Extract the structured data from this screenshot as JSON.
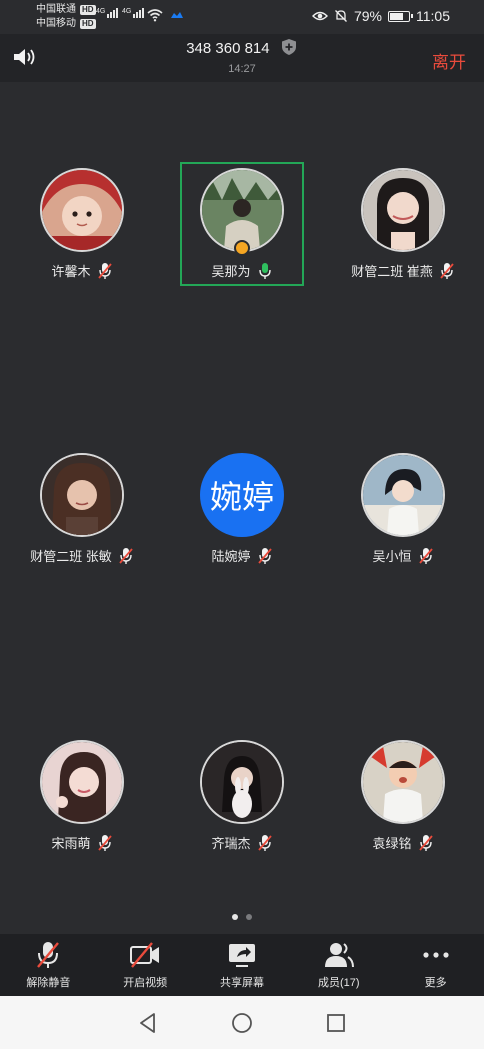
{
  "status": {
    "carrier1": "中国联通",
    "carrier2": "中国移动",
    "hd": "HD",
    "net1": "4G",
    "net2": "4G",
    "battery": "79%",
    "battery_level": 0.79,
    "time": "11:05"
  },
  "header": {
    "meeting_id": "348 360 814",
    "elapsed": "14:27",
    "leave_label": "离开"
  },
  "participants": [
    {
      "name": "许馨木",
      "mic": "muted",
      "avatar_color": "#c93a3a"
    },
    {
      "name": "吴那为",
      "mic": "on",
      "avatar_color": "#5f7a55",
      "host": true,
      "active": true
    },
    {
      "name": "财管二班  崔燕",
      "mic": "muted",
      "avatar_color": "#b0a8a0"
    },
    {
      "name": "财管二班 张敏",
      "mic": "muted",
      "avatar_color": "#4a3a34"
    },
    {
      "name": "陆婉婷",
      "mic": "muted",
      "avatar_text": "婉婷",
      "avatar_color": "#1971f2"
    },
    {
      "name": "吴小恒",
      "mic": "muted",
      "avatar_color": "#6f8fa6"
    },
    {
      "name": "宋雨萌",
      "mic": "muted",
      "avatar_color": "#d7b4b4"
    },
    {
      "name": "齐瑞杰",
      "mic": "muted",
      "avatar_color": "#2e2c2c"
    },
    {
      "name": "袁绿铭",
      "mic": "muted",
      "avatar_color": "#d04a3a"
    }
  ],
  "pager": {
    "current": 1,
    "total": 2
  },
  "toolbar": {
    "unmute": "解除静音",
    "video": "开启视频",
    "share": "共享屏幕",
    "members": "成员(17)",
    "more": "更多"
  },
  "colors": {
    "background": "#2b2c2f",
    "leave": "#e94b3c",
    "active_border": "#23a757",
    "mic_muted": "#e94b3c",
    "mic_on": "#2fbf5f"
  }
}
